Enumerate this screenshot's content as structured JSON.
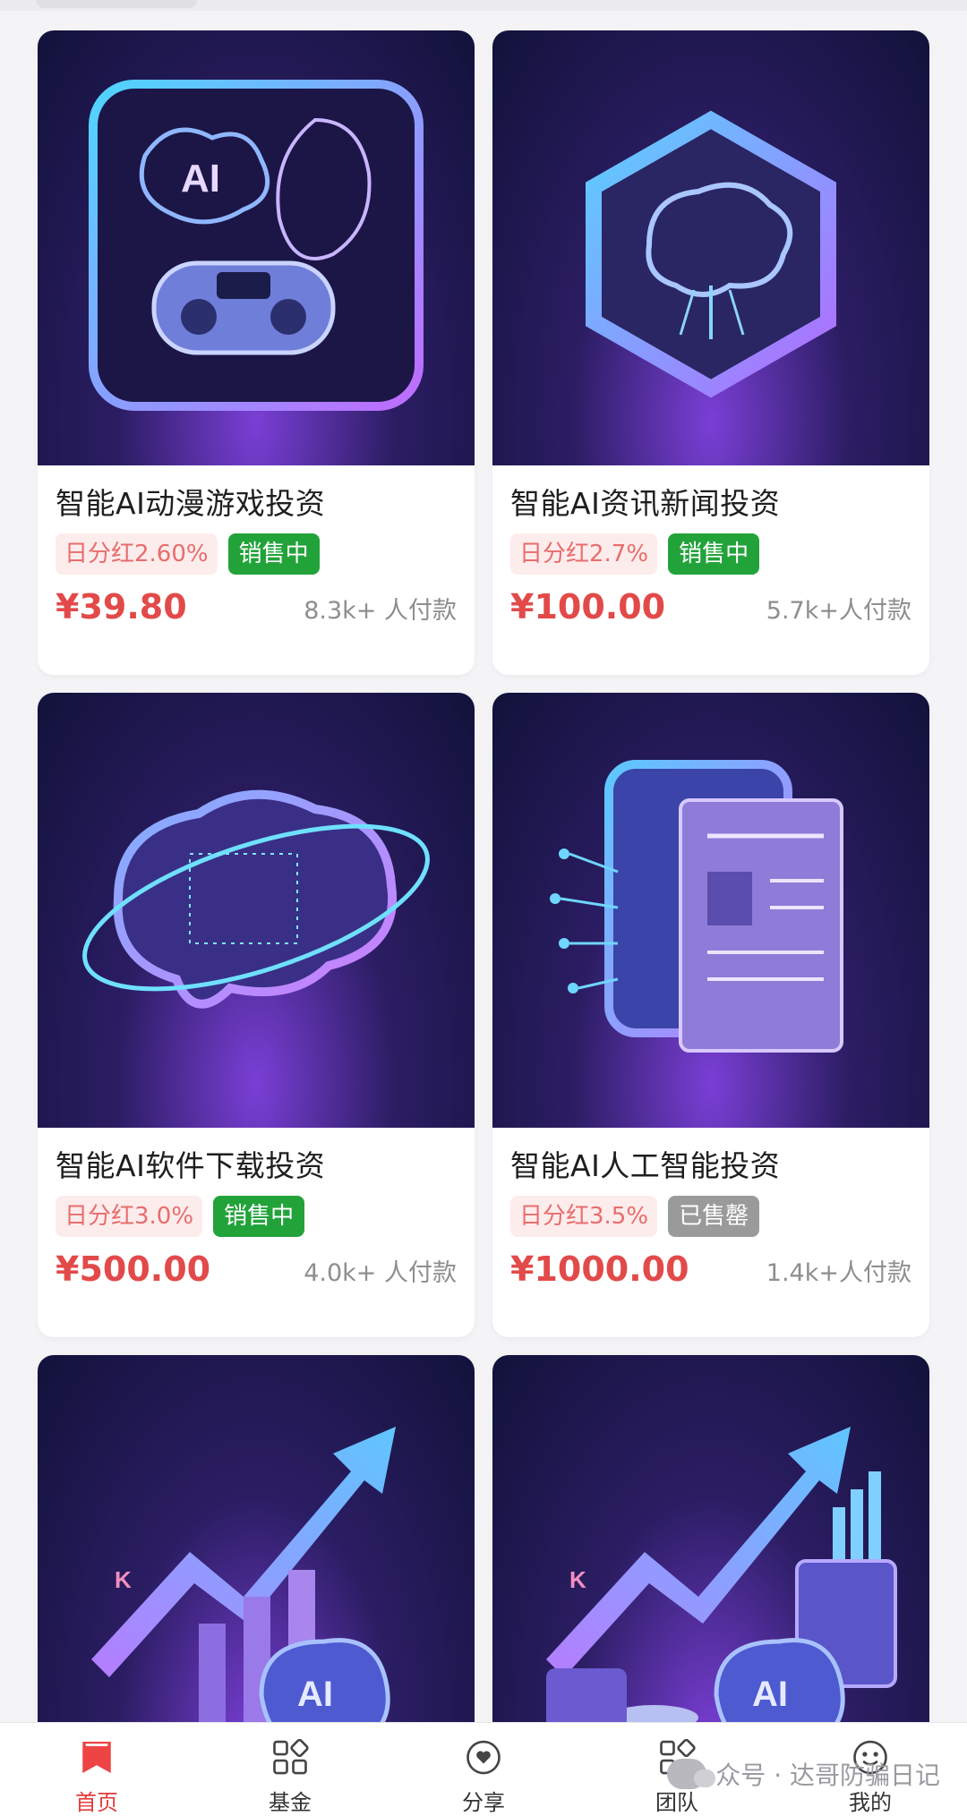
{
  "products": [
    {
      "title": "智能AI动漫游戏投资",
      "dividend": "日分红2.60%",
      "status": "销售中",
      "status_type": "selling",
      "price": "¥39.80",
      "buyers": "8.3k+ 人付款",
      "image_icon": "ai-brain-gamepad-icon"
    },
    {
      "title": "智能AI资讯新闻投资",
      "dividend": "日分红2.7%",
      "status": "销售中",
      "status_type": "selling",
      "price": "¥100.00",
      "buyers": "5.7k+人付款",
      "image_icon": "hexagon-brain-icon"
    },
    {
      "title": "智能AI软件下载投资",
      "dividend": "日分红3.0%",
      "status": "销售中",
      "status_type": "selling",
      "price": "¥500.00",
      "buyers": "4.0k+ 人付款",
      "image_icon": "brain-orbit-icon"
    },
    {
      "title": "智能AI人工智能投资",
      "dividend": "日分红3.5%",
      "status": "已售罄",
      "status_type": "soldout",
      "price": "¥1000.00",
      "buyers": "1.4k+人付款",
      "image_icon": "newspaper-circuit-icon"
    },
    {
      "title": "",
      "dividend": "",
      "status": "",
      "status_type": "",
      "price": "",
      "buyers": "",
      "image_icon": "growth-chart-brain-icon"
    },
    {
      "title": "",
      "dividend": "",
      "status": "",
      "status_type": "",
      "price": "",
      "buyers": "",
      "image_icon": "growth-chart-coins-icon"
    }
  ],
  "tabbar": {
    "items": [
      {
        "label": "首页",
        "icon": "bookmark-icon",
        "active": true
      },
      {
        "label": "基金",
        "icon": "grid-icon",
        "active": false
      },
      {
        "label": "分享",
        "icon": "chat-heart-icon",
        "active": false
      },
      {
        "label": "团队",
        "icon": "grid-icon",
        "active": false
      },
      {
        "label": "我的",
        "icon": "smiley-icon",
        "active": false
      }
    ]
  },
  "watermark": {
    "text": "众号 · 达哥防骗日记"
  },
  "colors": {
    "price": "#e24a4a",
    "selling": "#22a33a",
    "soldout": "#9a9a9a",
    "dividend_bg": "#fdecec",
    "dividend_text": "#e86d6d",
    "tab_active": "#e23b3b"
  }
}
